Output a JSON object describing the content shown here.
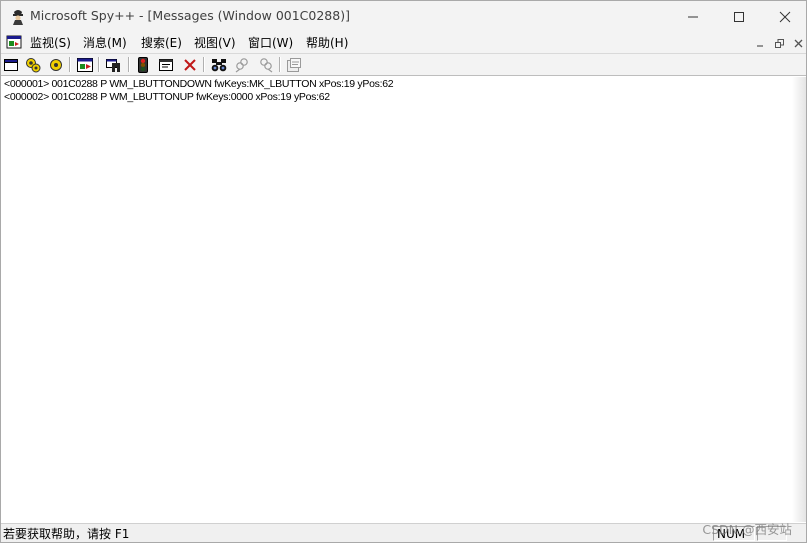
{
  "window": {
    "title": "Microsoft Spy++ - [Messages (Window 001C0288)]",
    "icon": "spy-agent-icon",
    "controls": [
      "minimize-icon",
      "maximize-icon",
      "close-icon"
    ]
  },
  "menubar": {
    "items": [
      {
        "label": "监视(S)"
      },
      {
        "label": "消息(M)"
      },
      {
        "label": "搜索(E)"
      },
      {
        "label": "视图(V)"
      },
      {
        "label": "窗口(W)"
      },
      {
        "label": "帮助(H)"
      }
    ],
    "mdi_controls": [
      "minimize-icon",
      "restore-icon",
      "close-icon"
    ]
  },
  "toolbar": {
    "buttons": [
      "windows-view-icon",
      "processes-view-icon",
      "threads-view-icon",
      "messages-view-icon",
      "find-window-icon",
      "start-logging-icon",
      "message-options-icon",
      "clear-log-icon",
      "find-icon",
      "find-next-icon",
      "find-previous-icon",
      "properties-icon"
    ]
  },
  "messages": [
    {
      "text": "<000001> 001C0288 P WM_LBUTTONDOWN fwKeys:MK_LBUTTON xPos:19 yPos:62"
    },
    {
      "text": "<000002> 001C0288 P WM_LBUTTONUP fwKeys:0000 xPos:19 yPos:62"
    }
  ],
  "statusbar": {
    "help_text": "若要获取帮助，请按 F1",
    "num_indicator": "NUM"
  },
  "watermark": "CSDN @西安站",
  "colors": {
    "chrome": "#f3f3f3",
    "list_background": "#ffffff"
  }
}
